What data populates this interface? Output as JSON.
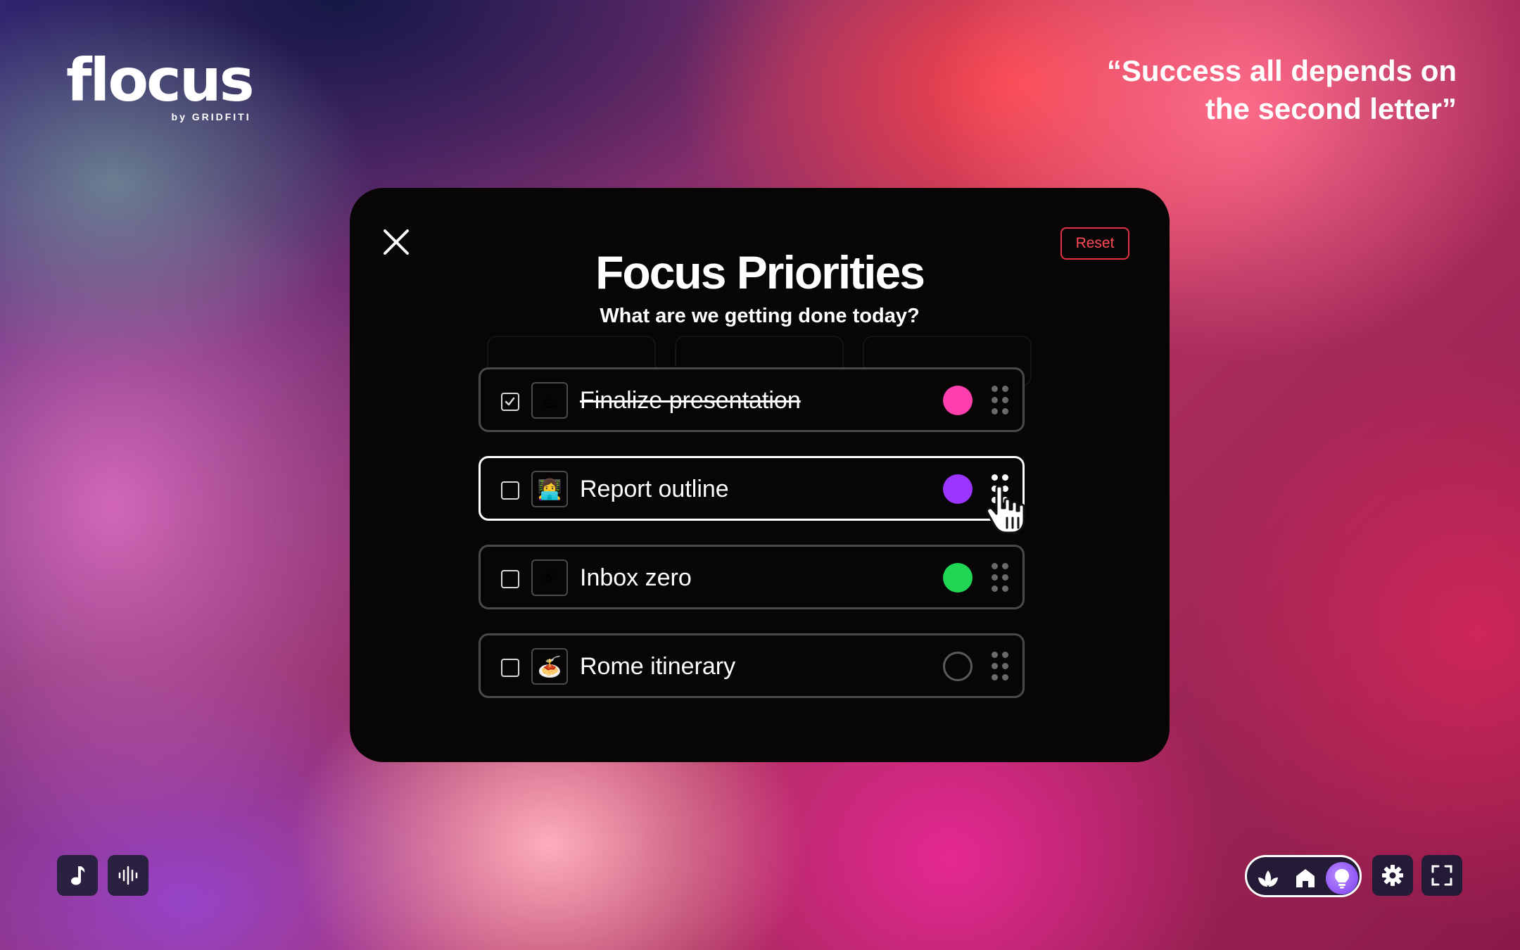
{
  "brand": {
    "name": "flocus",
    "byline": "by GRIDFITI"
  },
  "quote": "“Success all depends on the second letter”",
  "modal": {
    "title": "Focus Priorities",
    "subtitle": "What are we getting done today?",
    "reset_label": "Reset",
    "tasks": [
      {
        "label": "Finalize presentation",
        "emoji": "☕",
        "done": true,
        "color": "#ff3fae"
      },
      {
        "label": "Report outline",
        "emoji": "👩‍💻",
        "done": false,
        "color": "#9b35ff"
      },
      {
        "label": "Inbox zero",
        "emoji": "⚡",
        "done": false,
        "color": "#1fd655"
      },
      {
        "label": "Rome itinerary",
        "emoji": "🍝",
        "done": false,
        "color": ""
      }
    ]
  },
  "icons": {
    "bottom_left": [
      "music-note-icon",
      "sound-wave-icon"
    ],
    "bottom_right": [
      "plant-icon",
      "home-icon",
      "lightbulb-icon",
      "gear-icon",
      "fullscreen-icon"
    ]
  },
  "colors": {
    "reset": "#ff4b55",
    "selected_mode": "#8b48f5"
  }
}
